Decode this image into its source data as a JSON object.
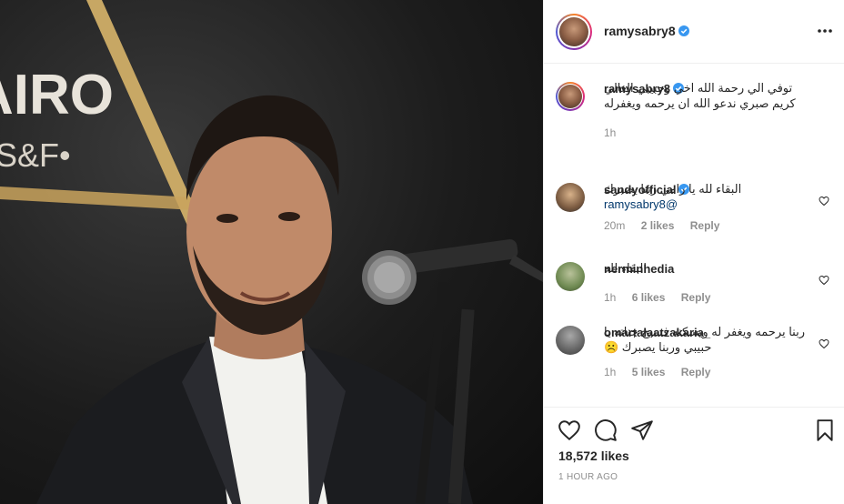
{
  "post": {
    "author": "ramysabry8",
    "caption": "توفي الي رحمة الله اخي وحبيبي الغالي كريم صبري ندعو الله ان يرحمه ويغفرله",
    "caption_time": "1h",
    "likes": "18,572 likes",
    "posted": "1 HOUR AGO"
  },
  "photo": {
    "sign_text_1": "AIRO",
    "sign_text_2": "S&F•"
  },
  "comments": [
    {
      "user": "sandyofficial",
      "verified": true,
      "text_1": "البقاء لله يا رامي ربنا يصبرك ",
      "mention": "@ramysabry8",
      "time": "20m",
      "likes": "2 likes",
      "reply": "Reply"
    },
    {
      "user": "nerminhedia",
      "verified": false,
      "text_1": "البقاء لله",
      "time": "1h",
      "likes": "6 likes",
      "reply": "Reply"
    },
    {
      "user": "omartalaatzakaria_",
      "verified": false,
      "text_1": "ربنا يرحمه ويغفر له ويسكنه فسيح جناته يا حبيبي وربنا يصبرك ☹️",
      "time": "1h",
      "likes": "5 likes",
      "reply": "Reply"
    }
  ],
  "icons": {
    "like": "heart-icon",
    "comment": "comment-icon",
    "share": "send-icon",
    "save": "bookmark-icon",
    "more": "more-options-icon",
    "verified": "verified-badge-icon"
  },
  "colors": {
    "verified": "#3897f0",
    "secondary_text": "#8e8e8e",
    "mention": "#00376b",
    "border": "#efefef"
  }
}
